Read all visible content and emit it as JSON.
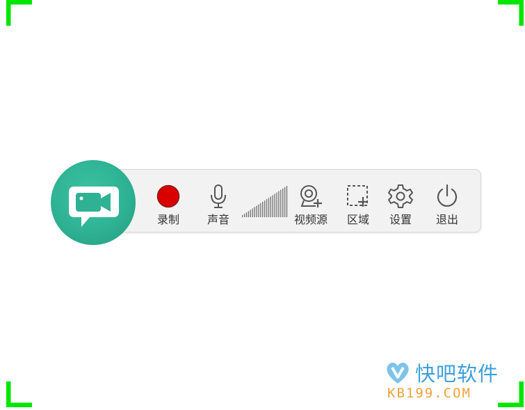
{
  "toolbar": {
    "record_label": "录制",
    "sound_label": "声音",
    "video_source_label": "视频源",
    "area_label": "区域",
    "settings_label": "设置",
    "exit_label": "退出"
  },
  "watermark": {
    "brand": "快吧软件",
    "url": "KB199.COM"
  },
  "colors": {
    "corner_green": "#00e600",
    "logo_teal": "#2eb293",
    "record_red": "#d90000",
    "icon_gray": "#555555",
    "watermark_blue": "#3ea0dd",
    "watermark_orange": "#f2a23c"
  },
  "icons": {
    "app_logo": "video-camera-chat-icon",
    "record": "record-dot-icon",
    "sound": "microphone-icon",
    "volume": "volume-bars-icon",
    "video_source": "webcam-icon",
    "area": "dashed-selection-icon",
    "settings": "gear-icon",
    "exit": "power-icon"
  }
}
